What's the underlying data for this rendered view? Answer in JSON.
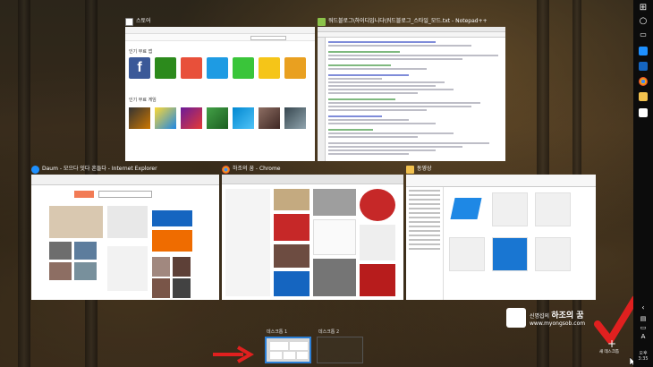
{
  "windows": {
    "store": {
      "title": "스토어",
      "section_apps": "인기 무료 앱",
      "section_games": "인기 무료 게임"
    },
    "notepad": {
      "title": "워드블로그\\하이디입니다\\워드블로그_스타일_모드.txt - Notepad++"
    },
    "ie": {
      "title": "Daum - 모으다 잇다 흔들다 - Internet Explorer"
    },
    "chrome": {
      "title": "하조의 꿈 - Chrome"
    },
    "explorer": {
      "title": "동영상"
    }
  },
  "desktops": [
    {
      "label": "데스크톱 1",
      "active": true
    },
    {
      "label": "데스크톱 2",
      "active": false
    }
  ],
  "new_desktop": {
    "label": "새 데스크톱"
  },
  "watermark": {
    "line1": "신명섭의",
    "line1b": "하조의 꿈",
    "line2": "www.myongsob.com"
  },
  "clock": {
    "time": "오후 3:35"
  },
  "colors": {
    "accent": "#2b7fd6",
    "arrow_red": "#e0201f"
  }
}
